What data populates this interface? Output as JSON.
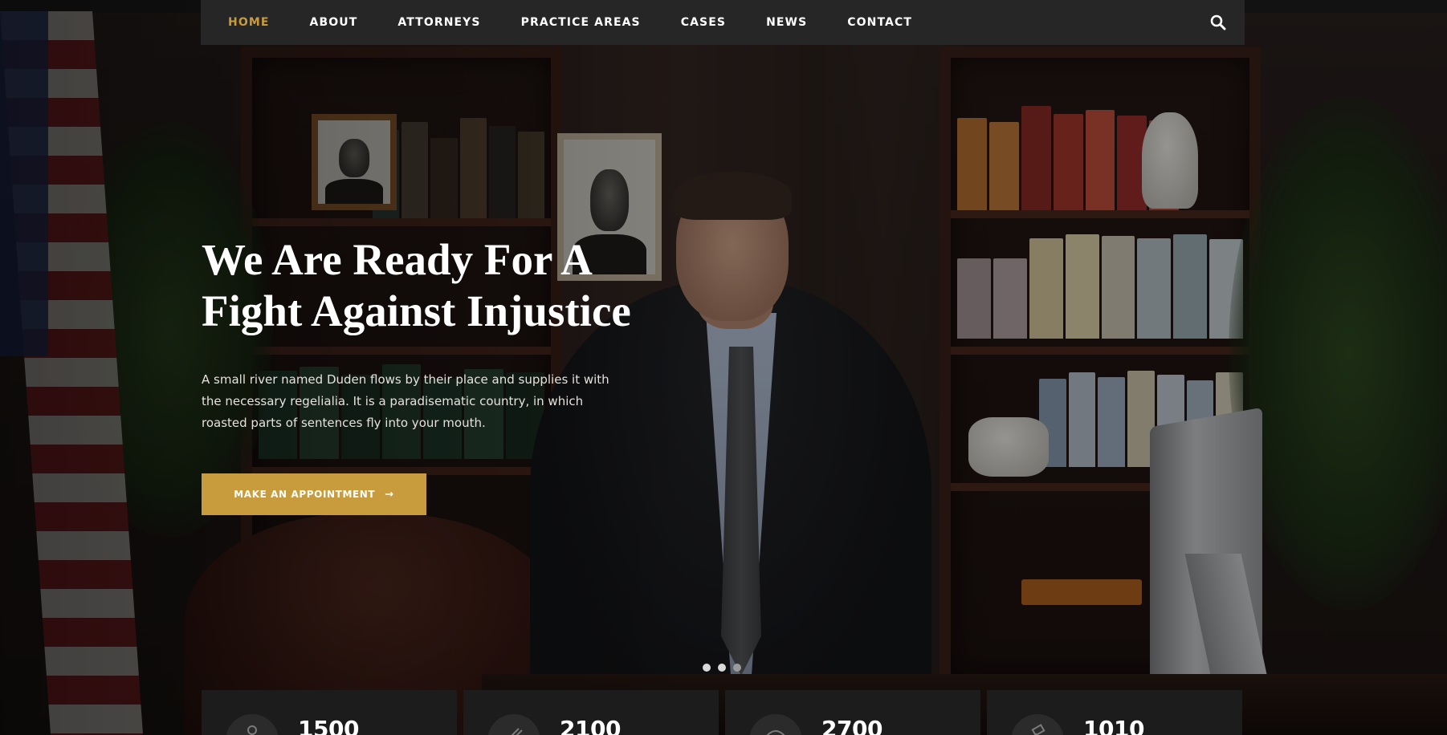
{
  "nav": {
    "items": [
      {
        "label": "HOME",
        "active": true
      },
      {
        "label": "ABOUT"
      },
      {
        "label": "ATTORNEYS"
      },
      {
        "label": "PRACTICE AREAS"
      },
      {
        "label": "CASES"
      },
      {
        "label": "NEWS"
      },
      {
        "label": "CONTACT"
      }
    ],
    "search_icon": "search-icon"
  },
  "hero": {
    "title_line1": "We Are Ready For A",
    "title_line2": "Fight Against Injustice",
    "text": "A small river named Duden flows by their place and supplies it with the necessary regelialia. It is a paradisematic country, in which roasted parts of sentences fly into your mouth.",
    "cta_label": "MAKE AN APPOINTMENT",
    "cta_icon": "arrow-right-icon",
    "slides_count": 3,
    "active_slide": 1
  },
  "stats": [
    {
      "value": "1500",
      "icon": "lawyer-icon"
    },
    {
      "value": "2100",
      "icon": "document-icon"
    },
    {
      "value": "2700",
      "icon": "handshake-icon"
    },
    {
      "value": "1010",
      "icon": "gavel-icon"
    }
  ],
  "colors": {
    "accent": "#c89b3c",
    "nav_bg": "#262626",
    "stat_bg": "#1c1c1c",
    "text_light": "#ffffff"
  }
}
